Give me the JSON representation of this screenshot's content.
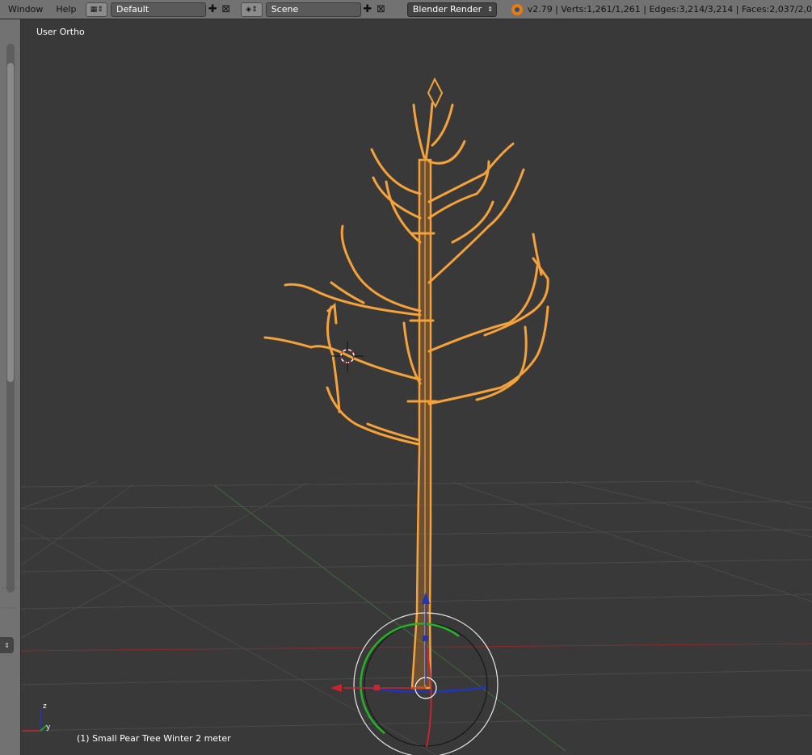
{
  "header": {
    "menus": [
      "Window",
      "Help"
    ],
    "screen_layout": "Default",
    "scene": "Scene",
    "render_engine": "Blender Render",
    "stats": "v2.79 | Verts:1,261/1,261 | Edges:3,214/3,214 | Faces:2,037/2,0"
  },
  "viewport": {
    "view_label": "User Ortho",
    "object_label": "(1) Small Pear Tree Winter 2 meter",
    "axes": {
      "z": "z",
      "y": "y"
    }
  },
  "icons": [
    "screen-layout-icon",
    "scene-icon",
    "add-icon",
    "close-icon",
    "blender-logo-icon",
    "3d-cursor-icon",
    "manipulator-icon"
  ],
  "colors": {
    "selection": "#f5a23a",
    "x_axis": "#c8262d",
    "y_axis": "#3c9a3c",
    "z_axis": "#2035b8"
  }
}
